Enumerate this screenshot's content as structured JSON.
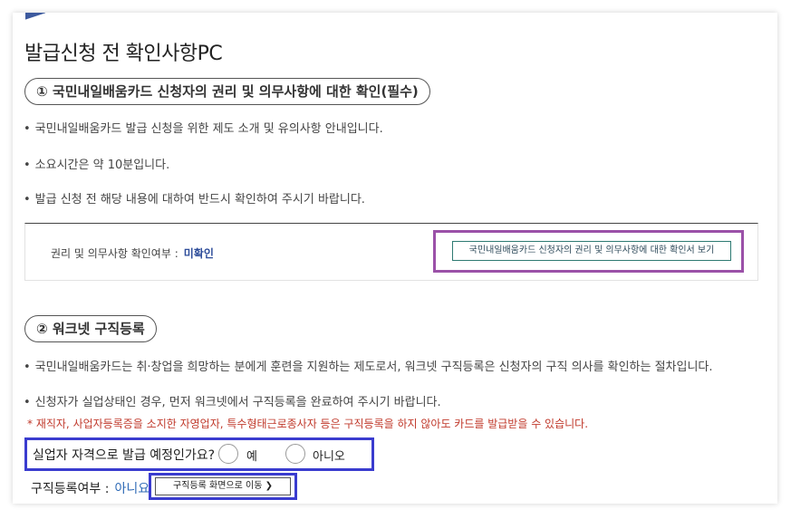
{
  "page": {
    "title": "발급신청 전 확인사항PC"
  },
  "section1": {
    "heading": "① 국민내일배움카드 신청자의 권리 및 의무사항에 대한 확인(필수)",
    "bullets": [
      "국민내일배움카드 발급 신청을 위한 제도 소개 및 유의사항 안내입니다.",
      "소요시간은 약 10분입니다.",
      "발급 신청 전 해당 내용에 대하여 반드시 확인하여 주시기 바랍니다."
    ],
    "check_label": "권리 및 의무사항 확인여부 :",
    "check_status": "미확인",
    "view_button": "국민내일배움카드 신청자의 권리 및 의무사항에 대한 확인서 보기"
  },
  "section2": {
    "heading": "② 워크넷 구직등록",
    "bullets": [
      "국민내일배움카드는 취·창업을 희망하는 분에게 훈련을 지원하는 제도로서, 워크넷 구직등록은 신청자의 구직 의사를 확인하는 절차입니다.",
      "신청자가 실업상태인 경우, 먼저 워크넷에서 구직등록을 완료하여 주시기 바랍니다."
    ],
    "warning": "* 재직자, 사업자등록증을 소지한 자영업자, 특수형태근로종사자 등은 구직등록을 하지 않아도 카드를 발급받을 수 있습니다.",
    "question": "실업자 자격으로 발급 예정인가요?",
    "options": [
      "예",
      "아니오"
    ],
    "registration_label": "구직등록여부 :",
    "registration_value": "아니요",
    "move_button": "구직등록 화면으로 이동 ❯"
  }
}
